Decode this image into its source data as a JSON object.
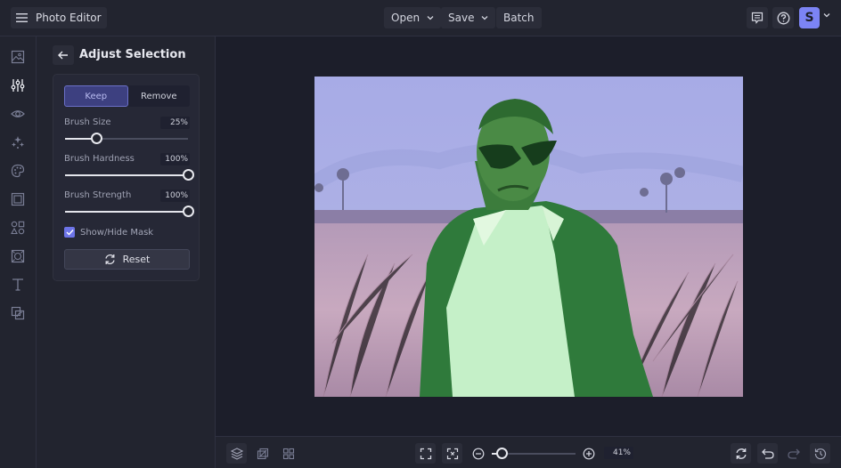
{
  "app": {
    "title": "Photo Editor"
  },
  "topbar": {
    "menu_icon": "hamburger-icon",
    "open_label": "Open",
    "save_label": "Save",
    "batch_label": "Batch",
    "feedback_icon": "comment-icon",
    "help_icon": "help-icon",
    "avatar_initial": "S"
  },
  "rail": {
    "items": [
      {
        "name": "image",
        "icon": "image-icon",
        "active": false
      },
      {
        "name": "adjust",
        "icon": "sliders-icon",
        "active": true
      },
      {
        "name": "view",
        "icon": "eye-icon",
        "active": false
      },
      {
        "name": "effects",
        "icon": "sparkle-icon",
        "active": false
      },
      {
        "name": "artsy",
        "icon": "palette-icon",
        "active": false
      },
      {
        "name": "frames",
        "icon": "frame-icon",
        "active": false
      },
      {
        "name": "graphics",
        "icon": "shapes-icon",
        "active": false
      },
      {
        "name": "overlays",
        "icon": "overlay-icon",
        "active": false
      },
      {
        "name": "text",
        "icon": "text-icon",
        "active": false
      },
      {
        "name": "textures",
        "icon": "texture-icon",
        "active": false
      }
    ]
  },
  "panel": {
    "title": "Adjust Selection",
    "mode_options": [
      "Keep",
      "Remove"
    ],
    "mode_selected": "Keep",
    "sliders": [
      {
        "label": "Brush Size",
        "value_text": "25%",
        "value": 25
      },
      {
        "label": "Brush Hardness",
        "value_text": "100%",
        "value": 100
      },
      {
        "label": "Brush Strength",
        "value_text": "100%",
        "value": 100
      }
    ],
    "show_mask_label": "Show/Hide Mask",
    "show_mask_checked": true,
    "reset_label": "Reset"
  },
  "bottombar": {
    "zoom_value_text": "41%",
    "zoom_percent": 41
  },
  "colors": {
    "accent": "#7c84f5",
    "mask_keep": "#2e7a3a",
    "mask_bg": "#a8aef0"
  }
}
